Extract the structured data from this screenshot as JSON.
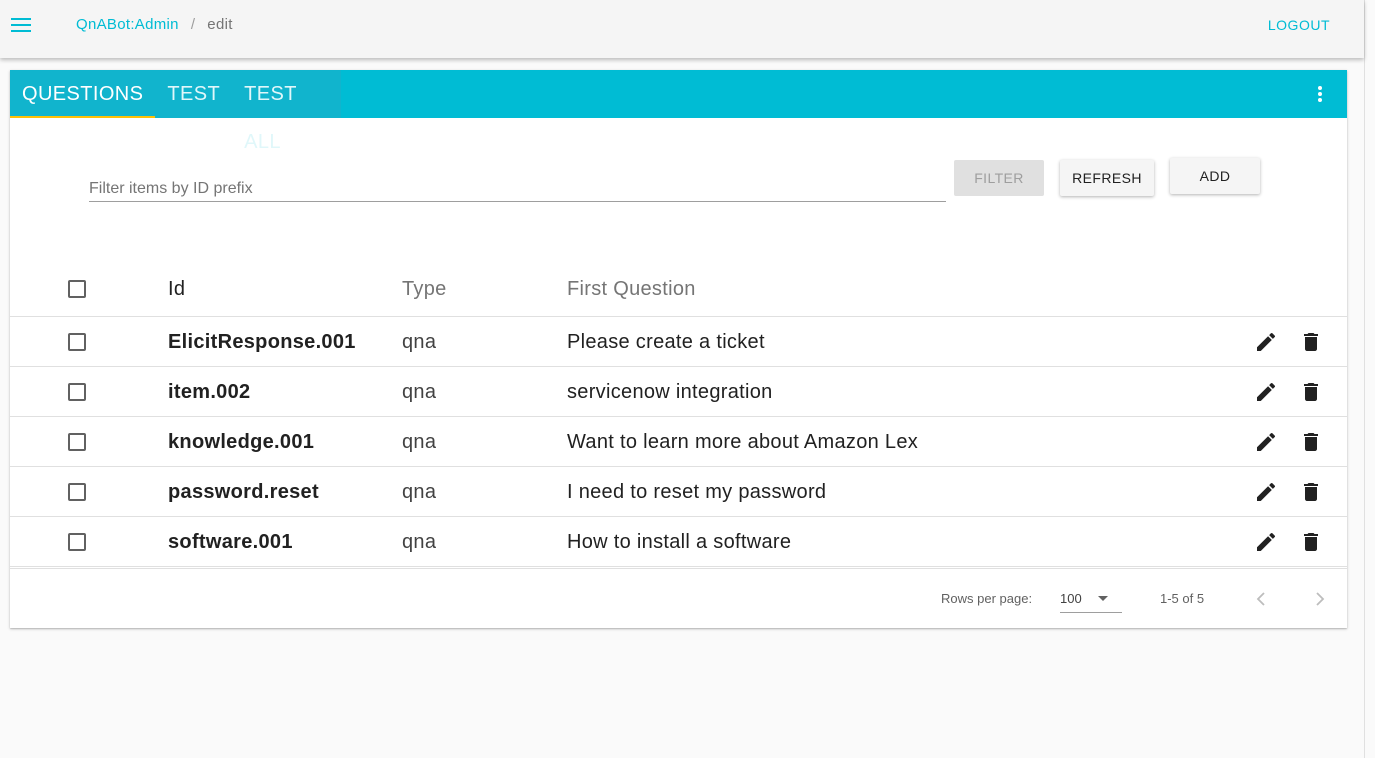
{
  "header": {
    "menu_icon": "menu-icon",
    "breadcrumb": {
      "app": "QnABot:Admin",
      "separator": "/",
      "current": "edit"
    },
    "logout_label": "LOGOUT"
  },
  "tabs": [
    {
      "label": "QUESTIONS",
      "active": true
    },
    {
      "label": "TEST",
      "active": false
    },
    {
      "label": "TEST ALL",
      "active": false
    }
  ],
  "toolbar": {
    "filter_placeholder": "Filter items by ID prefix",
    "filter_value": "",
    "filter_label": "FILTER",
    "refresh_label": "REFRESH",
    "add_label": "ADD"
  },
  "table": {
    "columns": {
      "id": "Id",
      "type": "Type",
      "question": "First Question"
    },
    "rows": [
      {
        "id": "ElicitResponse.001",
        "type": "qna",
        "question": "Please create a ticket"
      },
      {
        "id": "item.002",
        "type": "qna",
        "question": "servicenow integration"
      },
      {
        "id": "knowledge.001",
        "type": "qna",
        "question": "Want to learn more about Amazon Lex"
      },
      {
        "id": "password.reset",
        "type": "qna",
        "question": "I need to reset my password"
      },
      {
        "id": "software.001",
        "type": "qna",
        "question": "How to install a software"
      }
    ]
  },
  "pagination": {
    "rows_per_page_label": "Rows per page:",
    "rows_per_page": "100",
    "range": "1-5 of 5"
  },
  "colors": {
    "accent": "#00bcd4",
    "tab_indicator": "#ffc107"
  }
}
